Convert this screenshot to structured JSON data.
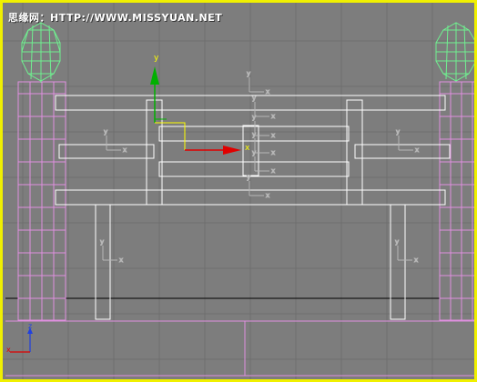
{
  "watermark": {
    "text": "思缘网：HTTP://WWW.MISSYUAN.NET"
  },
  "gizmo": {
    "x_label": "x",
    "y_label": "y"
  },
  "view_axis": {
    "z_label": "z",
    "x_label": "x"
  },
  "colors": {
    "viewport_background": "#7d7d7d",
    "active_border": "#f0f000",
    "grid_line": "#6f6f6f",
    "wireframe_white": "#ffffff",
    "wireframe_pink": "#e090e0",
    "wireframe_green": "#70f090",
    "gizmo_x": "#e00000",
    "gizmo_y": "#00b000",
    "horizon_line": "#000000"
  }
}
